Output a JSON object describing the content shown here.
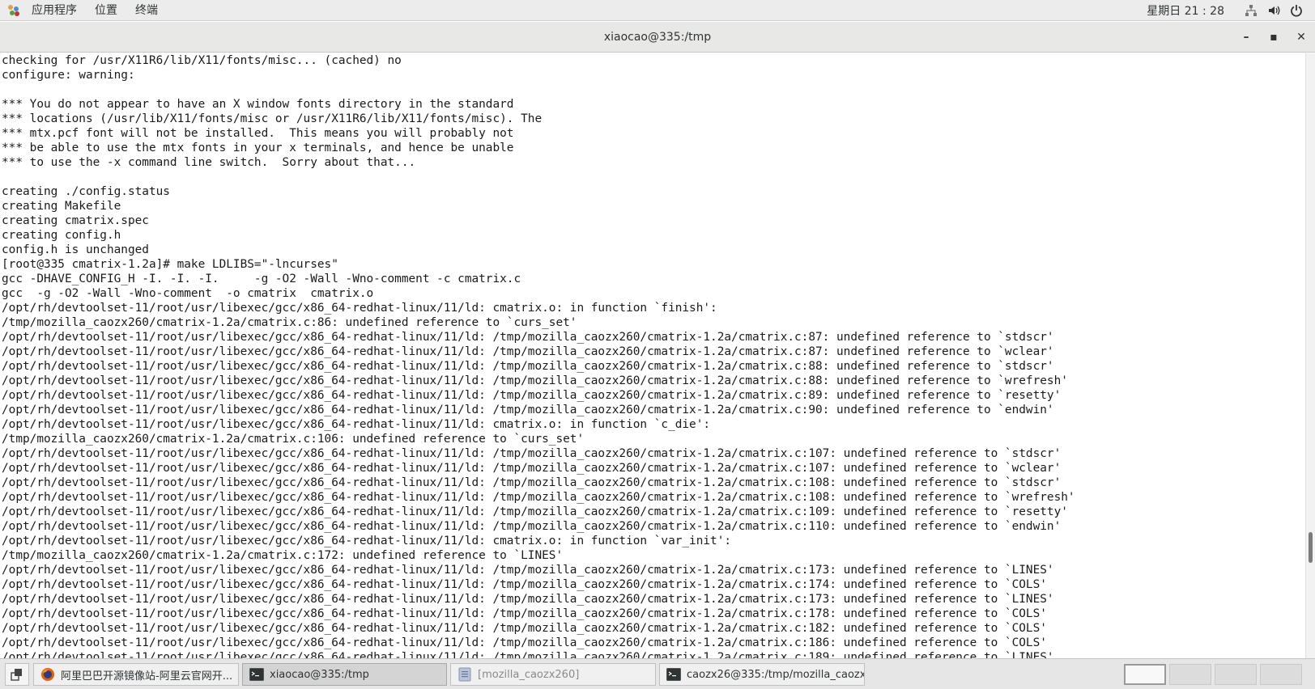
{
  "topbar": {
    "menu": [
      "应用程序",
      "位置",
      "终端"
    ],
    "clock": "星期日 21 : 28",
    "icons": [
      "network-icon",
      "volume-icon",
      "power-icon"
    ]
  },
  "window": {
    "title": "xiaocao@335:/tmp",
    "minimize": "–",
    "maximize": "▪",
    "close": "✕"
  },
  "terminal": {
    "lines": [
      "checking for /usr/X11R6/lib/X11/fonts/misc... (cached) no",
      "configure: warning:",
      "",
      "*** You do not appear to have an X window fonts directory in the standard",
      "*** locations (/usr/lib/X11/fonts/misc or /usr/X11R6/lib/X11/fonts/misc). The",
      "*** mtx.pcf font will not be installed.  This means you will probably not",
      "*** be able to use the mtx fonts in your x terminals, and hence be unable",
      "*** to use the -x command line switch.  Sorry about that...",
      "",
      "creating ./config.status",
      "creating Makefile",
      "creating cmatrix.spec",
      "creating config.h",
      "config.h is unchanged",
      "[root@335 cmatrix-1.2a]# make LDLIBS=\"-lncurses\"",
      "gcc -DHAVE_CONFIG_H -I. -I. -I.     -g -O2 -Wall -Wno-comment -c cmatrix.c",
      "gcc  -g -O2 -Wall -Wno-comment  -o cmatrix  cmatrix.o",
      "/opt/rh/devtoolset-11/root/usr/libexec/gcc/x86_64-redhat-linux/11/ld: cmatrix.o: in function `finish':",
      "/tmp/mozilla_caozx260/cmatrix-1.2a/cmatrix.c:86: undefined reference to `curs_set'",
      "/opt/rh/devtoolset-11/root/usr/libexec/gcc/x86_64-redhat-linux/11/ld: /tmp/mozilla_caozx260/cmatrix-1.2a/cmatrix.c:87: undefined reference to `stdscr'",
      "/opt/rh/devtoolset-11/root/usr/libexec/gcc/x86_64-redhat-linux/11/ld: /tmp/mozilla_caozx260/cmatrix-1.2a/cmatrix.c:87: undefined reference to `wclear'",
      "/opt/rh/devtoolset-11/root/usr/libexec/gcc/x86_64-redhat-linux/11/ld: /tmp/mozilla_caozx260/cmatrix-1.2a/cmatrix.c:88: undefined reference to `stdscr'",
      "/opt/rh/devtoolset-11/root/usr/libexec/gcc/x86_64-redhat-linux/11/ld: /tmp/mozilla_caozx260/cmatrix-1.2a/cmatrix.c:88: undefined reference to `wrefresh'",
      "/opt/rh/devtoolset-11/root/usr/libexec/gcc/x86_64-redhat-linux/11/ld: /tmp/mozilla_caozx260/cmatrix-1.2a/cmatrix.c:89: undefined reference to `resetty'",
      "/opt/rh/devtoolset-11/root/usr/libexec/gcc/x86_64-redhat-linux/11/ld: /tmp/mozilla_caozx260/cmatrix-1.2a/cmatrix.c:90: undefined reference to `endwin'",
      "/opt/rh/devtoolset-11/root/usr/libexec/gcc/x86_64-redhat-linux/11/ld: cmatrix.o: in function `c_die':",
      "/tmp/mozilla_caozx260/cmatrix-1.2a/cmatrix.c:106: undefined reference to `curs_set'",
      "/opt/rh/devtoolset-11/root/usr/libexec/gcc/x86_64-redhat-linux/11/ld: /tmp/mozilla_caozx260/cmatrix-1.2a/cmatrix.c:107: undefined reference to `stdscr'",
      "/opt/rh/devtoolset-11/root/usr/libexec/gcc/x86_64-redhat-linux/11/ld: /tmp/mozilla_caozx260/cmatrix-1.2a/cmatrix.c:107: undefined reference to `wclear'",
      "/opt/rh/devtoolset-11/root/usr/libexec/gcc/x86_64-redhat-linux/11/ld: /tmp/mozilla_caozx260/cmatrix-1.2a/cmatrix.c:108: undefined reference to `stdscr'",
      "/opt/rh/devtoolset-11/root/usr/libexec/gcc/x86_64-redhat-linux/11/ld: /tmp/mozilla_caozx260/cmatrix-1.2a/cmatrix.c:108: undefined reference to `wrefresh'",
      "/opt/rh/devtoolset-11/root/usr/libexec/gcc/x86_64-redhat-linux/11/ld: /tmp/mozilla_caozx260/cmatrix-1.2a/cmatrix.c:109: undefined reference to `resetty'",
      "/opt/rh/devtoolset-11/root/usr/libexec/gcc/x86_64-redhat-linux/11/ld: /tmp/mozilla_caozx260/cmatrix-1.2a/cmatrix.c:110: undefined reference to `endwin'",
      "/opt/rh/devtoolset-11/root/usr/libexec/gcc/x86_64-redhat-linux/11/ld: cmatrix.o: in function `var_init':",
      "/tmp/mozilla_caozx260/cmatrix-1.2a/cmatrix.c:172: undefined reference to `LINES'",
      "/opt/rh/devtoolset-11/root/usr/libexec/gcc/x86_64-redhat-linux/11/ld: /tmp/mozilla_caozx260/cmatrix-1.2a/cmatrix.c:173: undefined reference to `LINES'",
      "/opt/rh/devtoolset-11/root/usr/libexec/gcc/x86_64-redhat-linux/11/ld: /tmp/mozilla_caozx260/cmatrix-1.2a/cmatrix.c:174: undefined reference to `COLS'",
      "/opt/rh/devtoolset-11/root/usr/libexec/gcc/x86_64-redhat-linux/11/ld: /tmp/mozilla_caozx260/cmatrix-1.2a/cmatrix.c:173: undefined reference to `LINES'",
      "/opt/rh/devtoolset-11/root/usr/libexec/gcc/x86_64-redhat-linux/11/ld: /tmp/mozilla_caozx260/cmatrix-1.2a/cmatrix.c:178: undefined reference to `COLS'",
      "/opt/rh/devtoolset-11/root/usr/libexec/gcc/x86_64-redhat-linux/11/ld: /tmp/mozilla_caozx260/cmatrix-1.2a/cmatrix.c:182: undefined reference to `COLS'",
      "/opt/rh/devtoolset-11/root/usr/libexec/gcc/x86_64-redhat-linux/11/ld: /tmp/mozilla_caozx260/cmatrix-1.2a/cmatrix.c:186: undefined reference to `COLS'",
      "/opt/rh/devtoolset-11/root/usr/libexec/gcc/x86_64-redhat-linux/11/ld: /tmp/mozilla_caozx260/cmatrix-1.2a/cmatrix.c:189: undefined reference to `LINES'"
    ]
  },
  "taskbar": {
    "tasks": [
      {
        "label": "阿里巴巴开源镜像站-阿里云官网开...",
        "icon": "firefox-icon"
      },
      {
        "label": "xiaocao@335:/tmp",
        "icon": "terminal-icon"
      },
      {
        "label": "[mozilla_caozx260]",
        "icon": "file-manager-icon"
      },
      {
        "label": "caozx26@335:/tmp/mozilla_caozx-...",
        "icon": "terminal-icon"
      }
    ],
    "workspaces": 4,
    "current_workspace": 1
  }
}
